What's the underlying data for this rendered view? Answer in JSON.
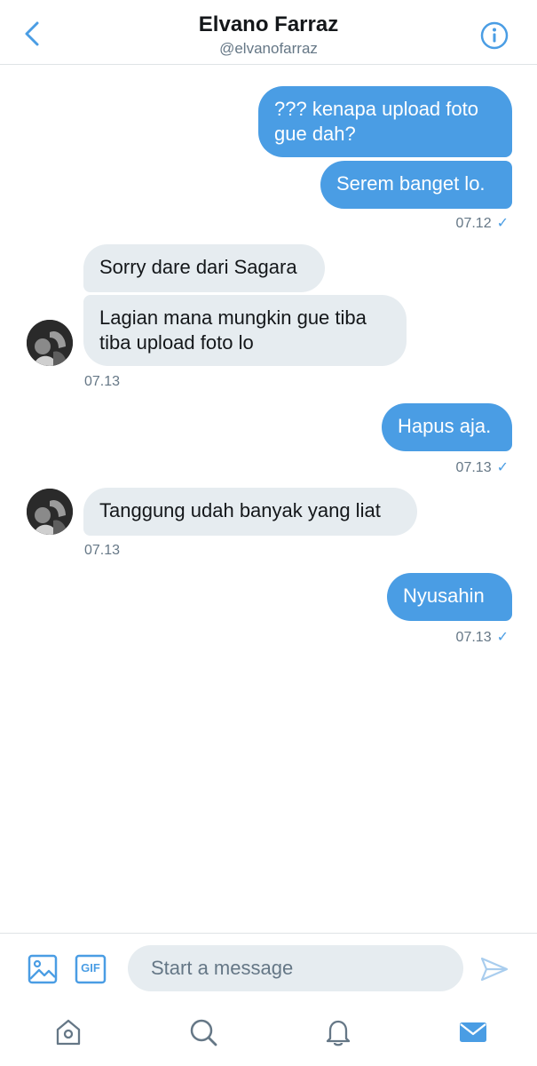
{
  "header": {
    "name": "Elvano Farraz",
    "handle": "@elvanofarraz",
    "back_icon": "chevron-left-icon",
    "info_icon": "info-icon"
  },
  "messages": [
    {
      "dir": "out",
      "text_lines": [
        "??? kenapa upload foto",
        "gue dah?"
      ]
    },
    {
      "dir": "out",
      "text": "Serem banget lo."
    },
    {
      "time": "07.12",
      "read": "✓"
    },
    {
      "dir": "in",
      "text": "Sorry dare dari Sagara"
    },
    {
      "dir": "in",
      "text_lines": [
        "Lagian mana mungkin gue tiba",
        "tiba upload foto lo"
      ]
    },
    {
      "time": "07.13"
    },
    {
      "dir": "out",
      "text": "Hapus aja."
    },
    {
      "time": "07.13",
      "read": "✓"
    },
    {
      "dir": "in",
      "text": "Tanggung udah banyak yang liat"
    },
    {
      "time": "07.13"
    },
    {
      "dir": "out",
      "text": "Nyusahin"
    },
    {
      "time": "07.13",
      "read": "✓"
    }
  ],
  "composer": {
    "placeholder": "Start a message",
    "gif_label": "GIF",
    "media_icon": "image-icon",
    "send_icon": "send-icon"
  },
  "tabbar": {
    "items": [
      "home-icon",
      "search-icon",
      "notifications-icon",
      "messages-icon"
    ],
    "active": "messages-icon"
  },
  "colors": {
    "accent": "#4a9de4",
    "incoming_bubble": "#e6ecf0",
    "muted_text": "#657786"
  }
}
